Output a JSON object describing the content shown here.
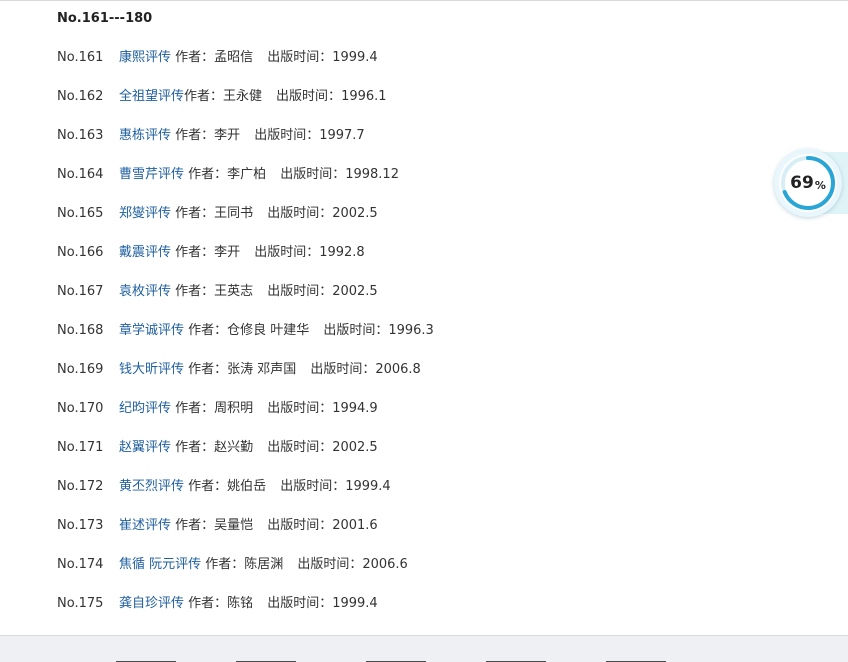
{
  "section": {
    "title": "No.161---180"
  },
  "labels": {
    "author": "作者：",
    "date": "出版时间："
  },
  "books": [
    {
      "no": "No.161",
      "title": "康熙评传",
      "author": "孟昭信",
      "date": "1999.4"
    },
    {
      "no": "No.162",
      "title": "全祖望评传",
      "author": "王永健",
      "date": "1996.1"
    },
    {
      "no": "No.163",
      "title": "惠栋评传",
      "author": "李开",
      "date": "1997.7"
    },
    {
      "no": "No.164",
      "title": "曹雪芹评传",
      "author": "李广柏",
      "date": "1998.12"
    },
    {
      "no": "No.165",
      "title": "郑燮评传",
      "author": "王同书",
      "date": "2002.5"
    },
    {
      "no": "No.166",
      "title": "戴震评传",
      "author": "李开",
      "date": "1992.8"
    },
    {
      "no": "No.167",
      "title": "袁枚评传",
      "author": "王英志",
      "date": "2002.5"
    },
    {
      "no": "No.168",
      "title": "章学诚评传",
      "author": "仓修良 叶建华",
      "date": "1996.3"
    },
    {
      "no": "No.169",
      "title": "钱大昕评传",
      "author": "张涛 邓声国",
      "date": "2006.8"
    },
    {
      "no": "No.170",
      "title": "纪昀评传",
      "author": "周积明",
      "date": "1994.9"
    },
    {
      "no": "No.171",
      "title": "赵翼评传",
      "author": "赵兴勤",
      "date": "2002.5"
    },
    {
      "no": "No.172",
      "title": "黄丕烈评传",
      "author": "姚伯岳",
      "date": "1999.4"
    },
    {
      "no": "No.173",
      "title": "崔述评传",
      "author": "吴量恺",
      "date": "2001.6"
    },
    {
      "no": "No.174",
      "title": "焦循 阮元评传",
      "author": "陈居渊",
      "date": "2006.6"
    },
    {
      "no": "No.175",
      "title": "龚自珍评传",
      "author": "陈铭",
      "date": "1999.4"
    }
  ],
  "widget": {
    "value": "69",
    "unit": "%",
    "progress": 0.69,
    "ring_color": "#2aa6d6",
    "track_color": "#d8eef5"
  },
  "colors": {
    "link": "#1f5fa0",
    "text": "#333333"
  }
}
